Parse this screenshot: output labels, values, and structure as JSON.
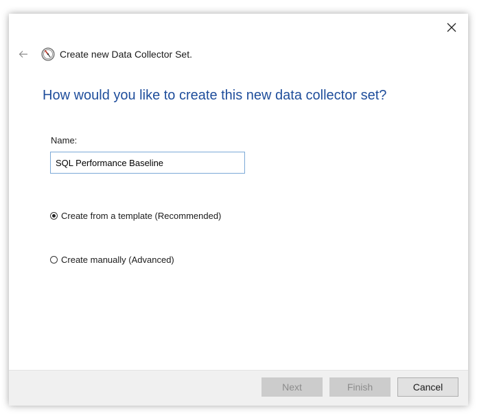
{
  "wizard": {
    "title": "Create new Data Collector Set.",
    "question": "How would you like to create this new data collector set?"
  },
  "name_field": {
    "label": "Name:",
    "value": "SQL Performance Baseline"
  },
  "options": [
    {
      "label": "Create from a template (Recommended)",
      "selected": true
    },
    {
      "label": "Create manually (Advanced)",
      "selected": false
    }
  ],
  "buttons": {
    "next": "Next",
    "finish": "Finish",
    "cancel": "Cancel"
  },
  "icons": {
    "back": "back-arrow-icon",
    "close": "close-icon",
    "app": "performance-monitor-icon"
  },
  "colors": {
    "question": "#1e4d9b",
    "input_border": "#7aa8d6",
    "footer_bg": "#f0f0f0",
    "disabled_button_bg": "#cccccc"
  }
}
